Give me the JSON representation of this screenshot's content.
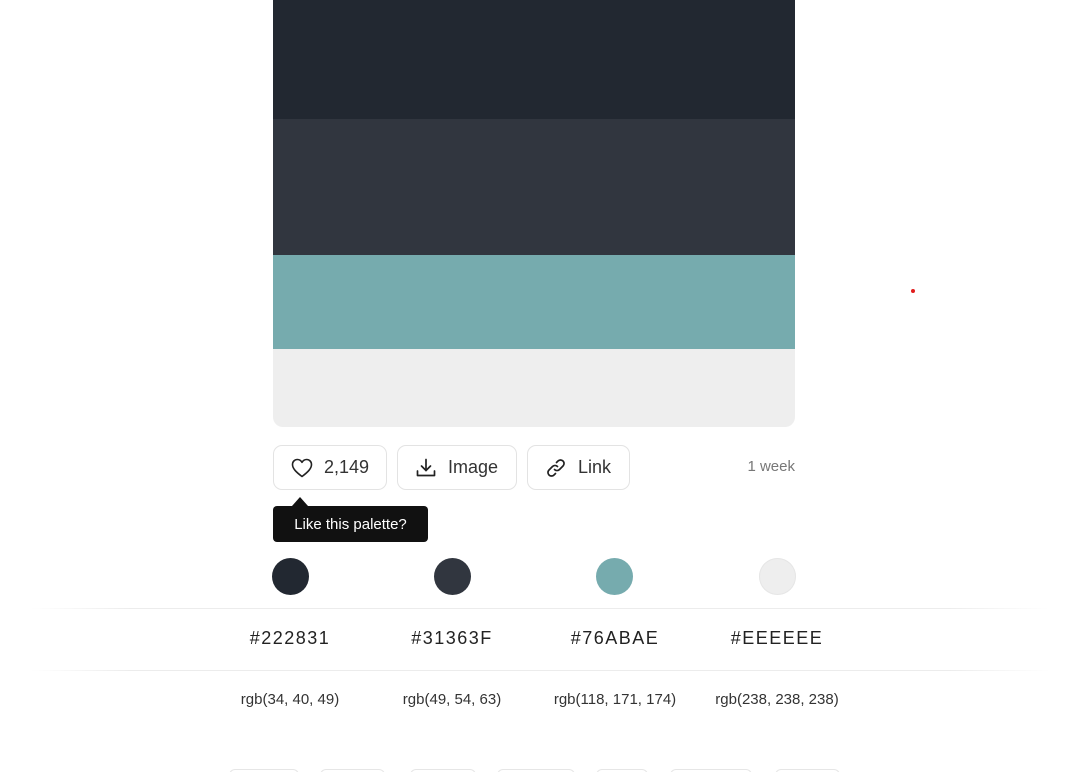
{
  "palette": {
    "swatches": [
      {
        "hex": "#222831"
      },
      {
        "hex": "#31363F"
      },
      {
        "hex": "#76ABAE"
      },
      {
        "hex": "#EEEEEE"
      }
    ]
  },
  "actions": {
    "like_icon": "heart-icon",
    "like_count": "2,149",
    "image_icon": "download-icon",
    "image_label": "Image",
    "link_icon": "link-icon",
    "link_label": "Link",
    "time": "1 week"
  },
  "tooltip": {
    "text": "Like this palette?"
  },
  "colors": [
    {
      "hex": "#222831",
      "rgb": "rgb(34, 40, 49)"
    },
    {
      "hex": "#31363F",
      "rgb": "rgb(49, 54, 63)"
    },
    {
      "hex": "#76ABAE",
      "rgb": "rgb(118, 171, 174)"
    },
    {
      "hex": "#EEEEEE",
      "rgb": "rgb(238, 238, 238)"
    }
  ],
  "cursor_marker_color": "#E11D1D"
}
